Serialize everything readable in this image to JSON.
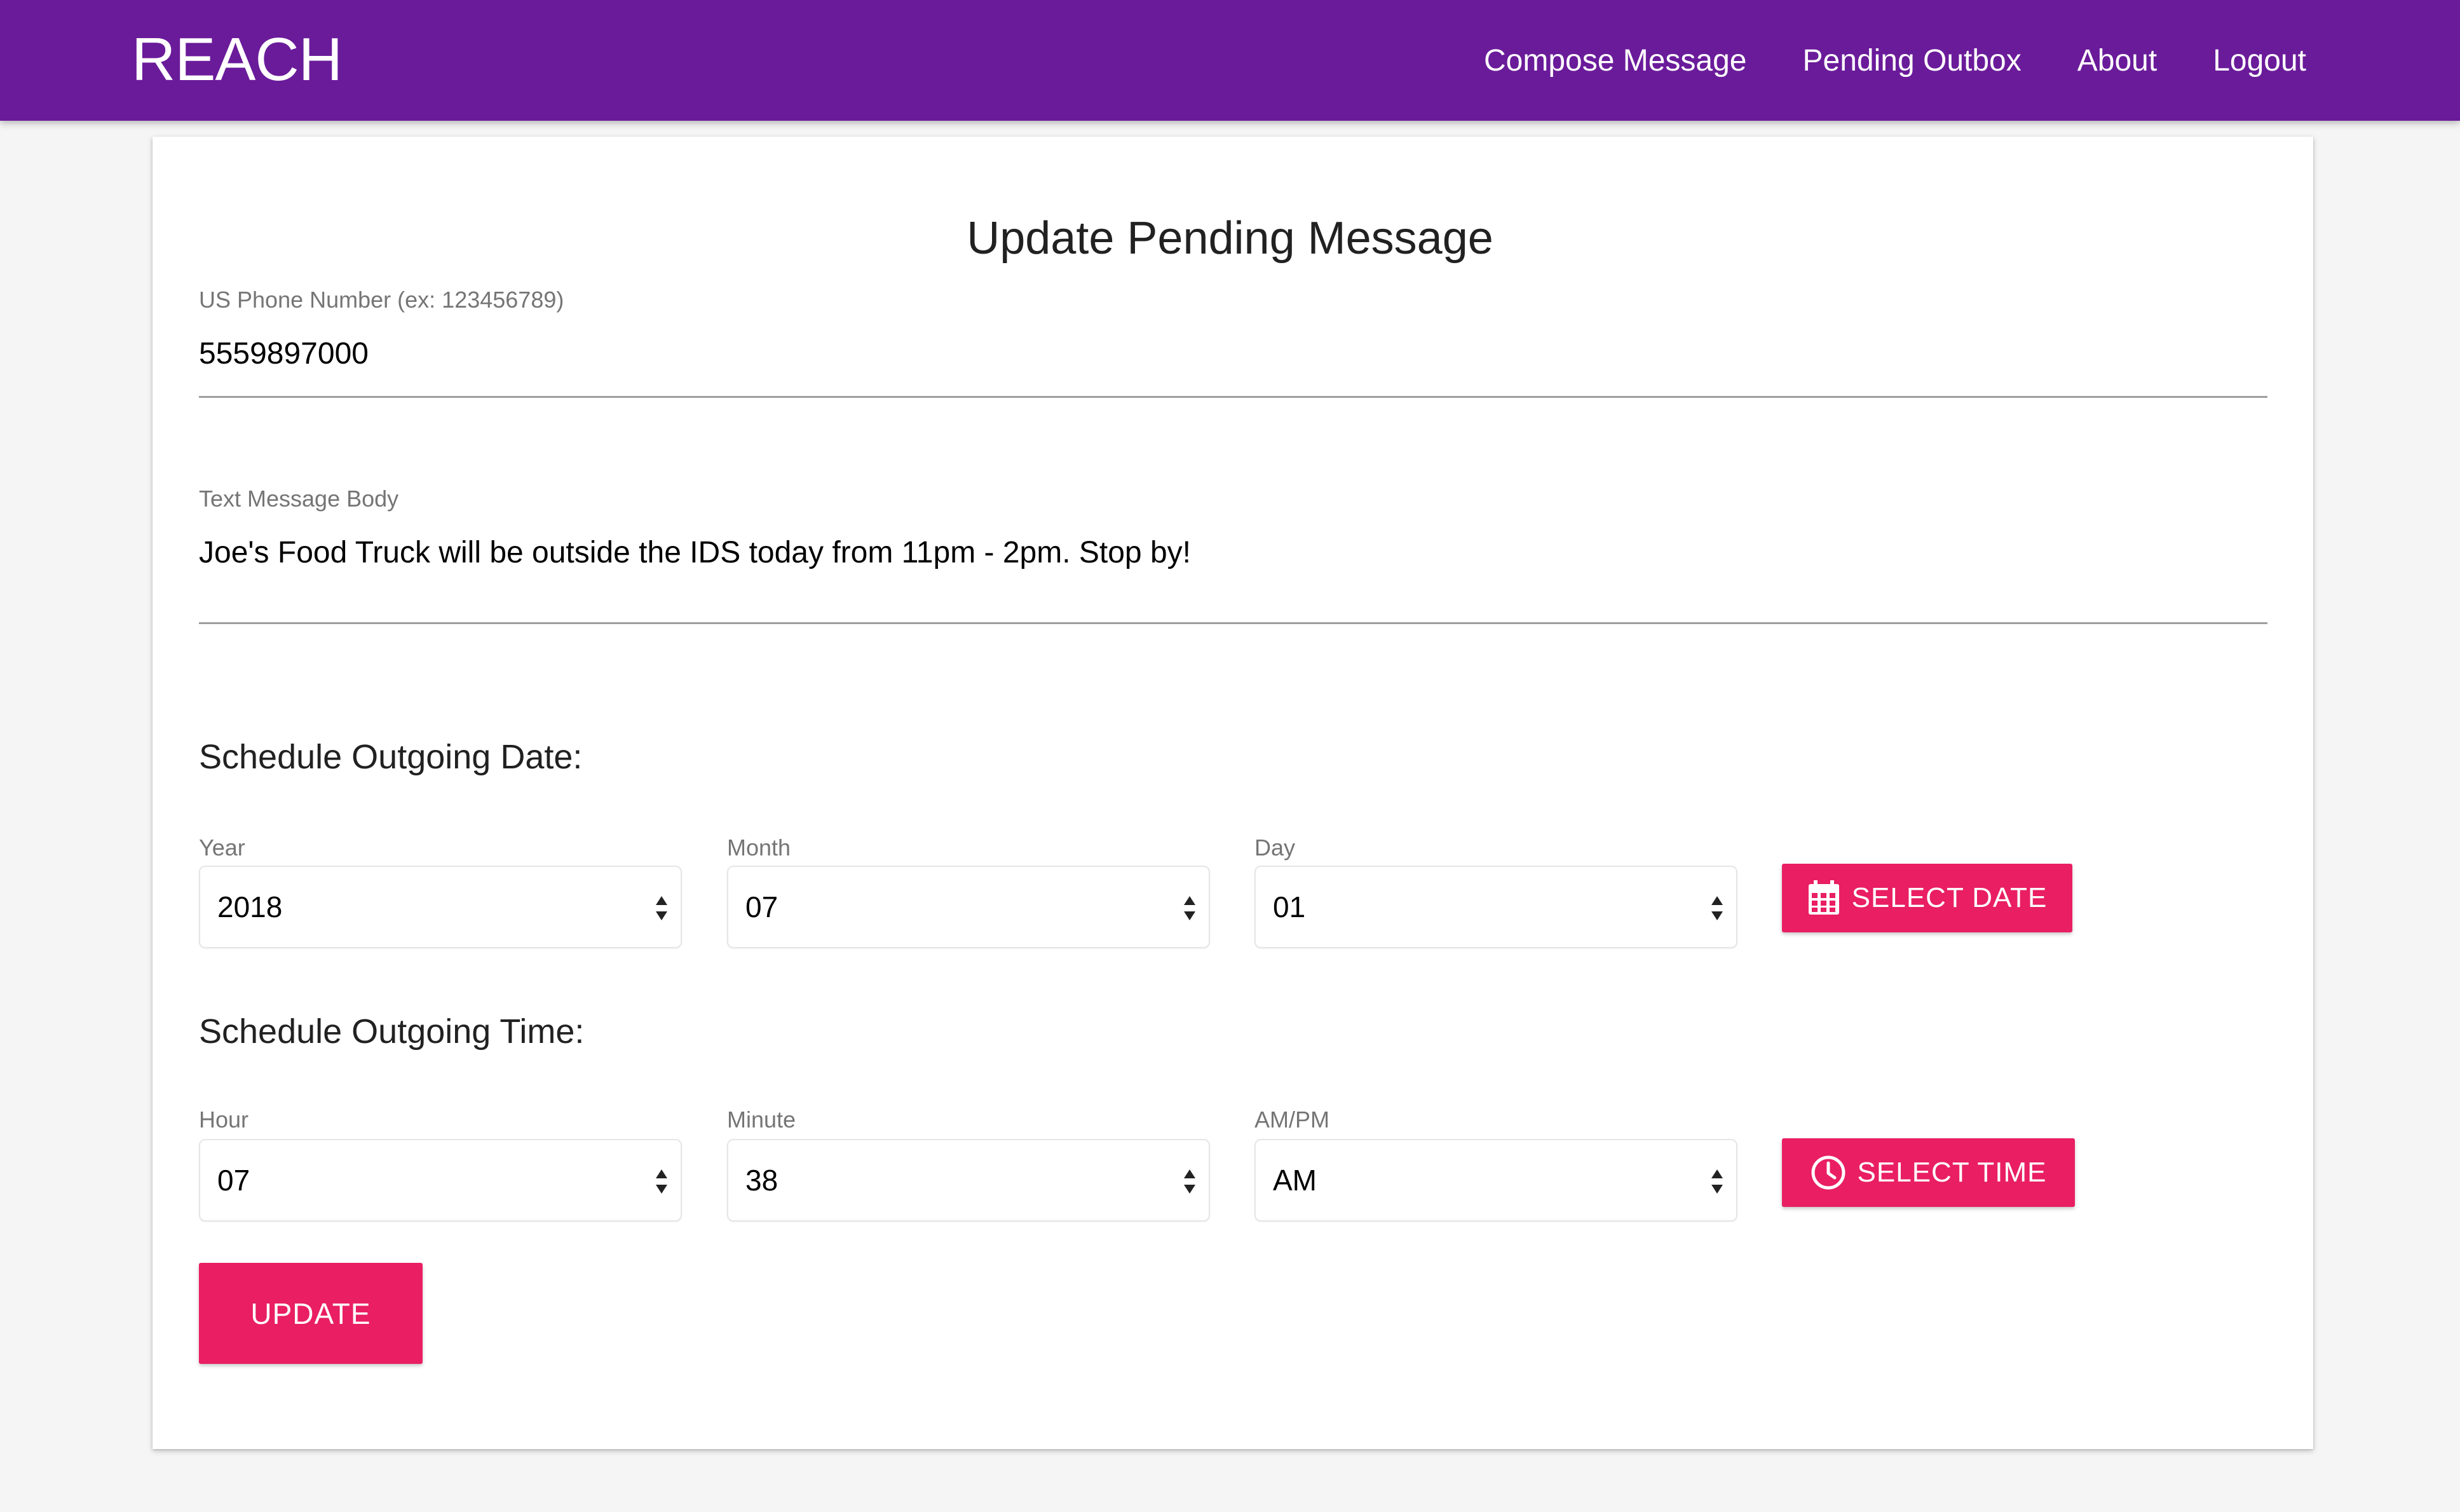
{
  "app": {
    "brand": "REACH"
  },
  "nav": {
    "items": [
      {
        "label": "Compose Message"
      },
      {
        "label": "Pending Outbox"
      },
      {
        "label": "About"
      },
      {
        "label": "Logout"
      }
    ]
  },
  "form": {
    "title": "Update Pending Message",
    "phone": {
      "label": "US Phone Number (ex: 123456789)",
      "value": "5559897000"
    },
    "body": {
      "label": "Text Message Body",
      "value": "Joe's Food Truck will be outside the IDS today from 11pm - 2pm. Stop by!"
    },
    "date_heading": "Schedule Outgoing Date:",
    "year": {
      "label": "Year",
      "value": "2018"
    },
    "month": {
      "label": "Month",
      "value": "07"
    },
    "day": {
      "label": "Day",
      "value": "01"
    },
    "select_date_label": "SELECT DATE",
    "time_heading": "Schedule Outgoing Time:",
    "hour": {
      "label": "Hour",
      "value": "07"
    },
    "minute": {
      "label": "Minute",
      "value": "38"
    },
    "ampm": {
      "label": "AM/PM",
      "value": "AM"
    },
    "select_time_label": "SELECT TIME",
    "update_label": "UPDATE"
  },
  "colors": {
    "header": "#6a1b9a",
    "accent": "#e91e63",
    "background": "#f5f5f5"
  },
  "icons": {
    "select_date": "calendar-icon",
    "select_time": "clock-icon"
  }
}
